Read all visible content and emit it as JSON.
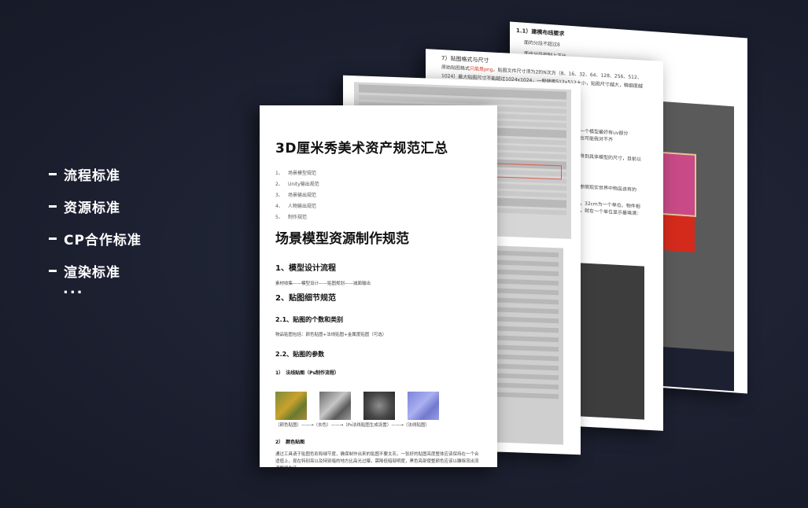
{
  "menu": {
    "items": [
      "流程标准",
      "资源标准",
      "CP合作标准",
      "渲染标准"
    ],
    "more": "..."
  },
  "page5": {
    "heading": "1.1）建模布线要求",
    "lines": [
      "面的分段不超过8",
      "面也分段控制上下比"
    ]
  },
  "page4": {
    "heading": "7）贴图格式与尺寸",
    "line1_pre": "原始贴图格式",
    "line1_hl": "只能是png",
    "line1_post": "。贴图文件尺寸须为2的N次方（8、16、32、64、128、256、512、",
    "line2": "1024）最大贴图尺寸不能超过1024x1024，一般使用512x512大小，贴图尺寸越大，精细度越",
    "line3": "高，但同样会占用越多的资源。",
    "right": [
      "一个模型最好有uv部分",
      "也可能我对不齐",
      "寻到具体模型的尺寸，目前以",
      "参照现实世界中物品该有的",
      "，32cm为一个单位。物件相",
      "，就在一个单位显示最填满："
    ]
  },
  "doc": {
    "title": "3D厘米秀美术资产规范汇总",
    "toc": [
      {
        "n": "1、",
        "label": "场景模型规范"
      },
      {
        "n": "2、",
        "label": "Unity输出规范"
      },
      {
        "n": "3、",
        "label": "场景输出规范"
      },
      {
        "n": "4、",
        "label": "人物输出规范"
      },
      {
        "n": "5、",
        "label": "制作规范"
      }
    ],
    "section_title": "场景模型资源制作规范",
    "h_design": "1、模型设计流程",
    "flow": "素材收集——模型设计——贴图规划——减面输出",
    "h_texture": "2、贴图细节规范",
    "h_count": "2.1、贴图的个数和类别",
    "count_text": "物品贴图包括：颜色贴图+法线贴图+金属度贴图（可选）",
    "h_params": "2.2、贴图的参数",
    "h_normal": "1）　法线贴图（Ps制作流程）",
    "maps_caption": "（颜色贴图）——→（去色）——→（Ps法线贴图生成设置）——→（法线贴图）",
    "h_color": "2）　颜色贴图",
    "para": "通过工具请于贴图色彩和细节度，确保制作出来的贴图不要太灰。一张好的贴图亮度整体应该保持在一个合适值上，现在特别亮以及特别暗的地方比高光过曝，需降低暗部明度，黑色亮部使整颜色应该以雕琢流出流调整增为佳。"
  }
}
